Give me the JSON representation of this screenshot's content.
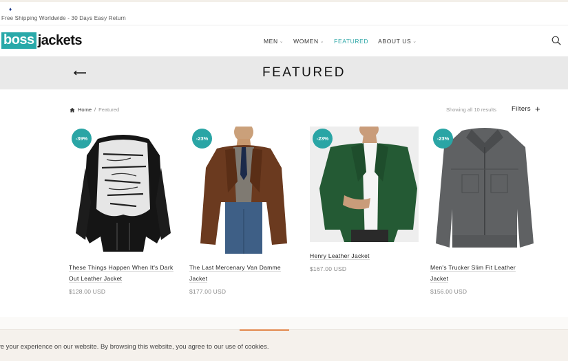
{
  "announcement": {
    "text": "Free Shipping Worldwide - 30 Days Easy Return"
  },
  "brand": {
    "part1": "boss",
    "part2": "jackets",
    "accent": "#29a9a9"
  },
  "nav": {
    "items": [
      {
        "label": "MEN",
        "has_dropdown": true
      },
      {
        "label": "WOMEN",
        "has_dropdown": true
      },
      {
        "label": "FEATURED",
        "has_dropdown": false
      },
      {
        "label": "ABOUT US",
        "has_dropdown": true
      }
    ],
    "chevron": "⌄"
  },
  "icons": {
    "search": "search-icon",
    "back": "arrow-left-icon",
    "home": "home-icon",
    "plus": "plus-icon"
  },
  "page": {
    "title": "FEATURED"
  },
  "breadcrumb": {
    "home": "Home",
    "separator": "/",
    "current": "Featured"
  },
  "results": {
    "text": "Showing all 10 results"
  },
  "filters": {
    "label": "Filters",
    "plus": "+"
  },
  "products": [
    {
      "title_line1": "These Things Happen When It's Dark",
      "title_line2": "Out Leather Jacket",
      "price": "$128.00 USD",
      "discount": "-39%"
    },
    {
      "title_line1": "The Last Mercenary Van Damme",
      "title_line2": "Jacket",
      "price": "$177.00 USD",
      "discount": "-23%"
    },
    {
      "title_line1": "Henry Leather Jacket",
      "title_line2": "",
      "price": "$167.00 USD",
      "discount": "-23%"
    },
    {
      "title_line1": "Men's Trucker Slim Fit Leather",
      "title_line2": "Jacket",
      "price": "$156.00 USD",
      "discount": "-23%"
    }
  ],
  "cookie": {
    "message": "ve your experience on our website. By browsing this website, you agree to our use of cookies."
  },
  "colors": {
    "teal": "#2aa5a5",
    "banner": "#e9e9e9",
    "cookie_accent": "#e2874b"
  }
}
